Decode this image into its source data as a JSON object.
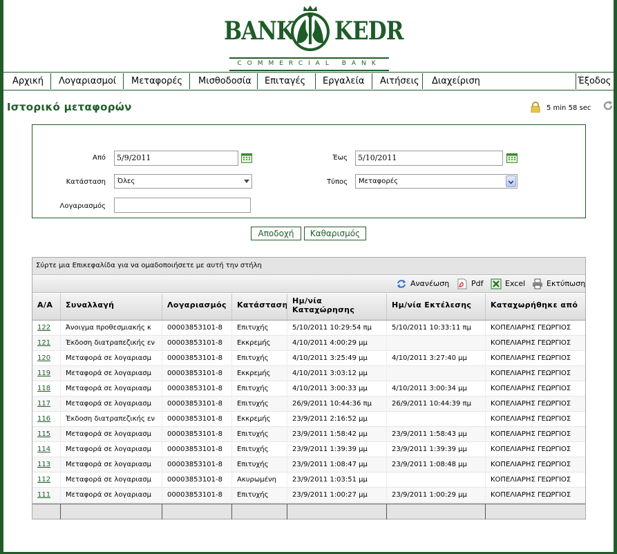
{
  "logo": {
    "left_word": "BANK",
    "right_word": "KEDR",
    "tagline": "COMMERCIAL BANK"
  },
  "nav": [
    {
      "label": "Αρχική"
    },
    {
      "label": "Λογαριασμοί"
    },
    {
      "label": "Μεταφορές"
    },
    {
      "label": "Μισθοδοσία"
    },
    {
      "label": "Επιταγές"
    },
    {
      "label": "Εργαλεία"
    },
    {
      "label": "Αιτήσεις"
    },
    {
      "label": "Διαχείριση"
    }
  ],
  "logout_label": "Έξοδος",
  "page_title": "Ιστορικό μεταφορών",
  "session_timer": "5 min 58 sec",
  "filter": {
    "from_label": "Από",
    "from_value": "5/9/2011",
    "to_label": "Έως",
    "to_value": "5/10/2011",
    "status_label": "Κατάσταση",
    "status_value": "Όλες",
    "type_label": "Τύπος",
    "type_value": "Μεταφορές",
    "account_label": "Λογαριασμός",
    "account_value": ""
  },
  "buttons": {
    "accept": "Αποδοχή",
    "clear": "Καθαρισμός"
  },
  "grid": {
    "group_hint": "Σύρτε μια Επικεφαλίδα για να ομαδοποιήσετε με αυτή την στήλη",
    "toolbar": {
      "refresh": "Ανανέωση",
      "pdf": "Pdf",
      "excel": "Excel",
      "print": "Εκτύπωση"
    },
    "columns": [
      {
        "label": "Α/Α"
      },
      {
        "label": "Συναλλαγή"
      },
      {
        "label": "Λογαριασμός"
      },
      {
        "label": "Κατάσταση"
      },
      {
        "label": "Ημ/νία Καταχώρησης"
      },
      {
        "label": "Ημ/νία Εκτέλεσης"
      },
      {
        "label": "Καταχωρήθηκε από"
      }
    ],
    "rows": [
      {
        "aa": "122",
        "tx": "Άνοιγμα προθεσμιακής κ",
        "acct": "00003853101-8",
        "status": "Επιτυχής",
        "reg": "5/10/2011 10:29:54 πμ",
        "exec": "5/10/2011 10:33:11 πμ",
        "by": "ΚΟΠΕΛΙΑΡΗΣ ΓΕΩΡΓΙΟΣ"
      },
      {
        "aa": "121",
        "tx": "Έκδοση διατραπεζικής εν",
        "acct": "00003853101-8",
        "status": "Εκκρεμής",
        "reg": "4/10/2011 4:00:29 μμ",
        "exec": "",
        "by": "ΚΟΠΕΛΙΑΡΗΣ ΓΕΩΡΓΙΟΣ"
      },
      {
        "aa": "120",
        "tx": "Μεταφορά σε λογαριασμ",
        "acct": "00003853101-8",
        "status": "Επιτυχής",
        "reg": "4/10/2011 3:25:49 μμ",
        "exec": "4/10/2011 3:27:40 μμ",
        "by": "ΚΟΠΕΛΙΑΡΗΣ ΓΕΩΡΓΙΟΣ"
      },
      {
        "aa": "119",
        "tx": "Μεταφορά σε λογαριασμ",
        "acct": "00003853101-8",
        "status": "Εκκρεμής",
        "reg": "4/10/2011 3:03:12 μμ",
        "exec": "",
        "by": "ΚΟΠΕΛΙΑΡΗΣ ΓΕΩΡΓΙΟΣ"
      },
      {
        "aa": "118",
        "tx": "Μεταφορά σε λογαριασμ",
        "acct": "00003853101-8",
        "status": "Επιτυχής",
        "reg": "4/10/2011 3:00:33 μμ",
        "exec": "4/10/2011 3:00:34 μμ",
        "by": "ΚΟΠΕΛΙΑΡΗΣ ΓΕΩΡΓΙΟΣ"
      },
      {
        "aa": "117",
        "tx": "Μεταφορά σε λογαριασμ",
        "acct": "00003853101-8",
        "status": "Επιτυχής",
        "reg": "26/9/2011 10:44:36 πμ",
        "exec": "26/9/2011 10:44:39 πμ",
        "by": "ΚΟΠΕΛΙΑΡΗΣ ΓΕΩΡΓΙΟΣ"
      },
      {
        "aa": "116",
        "tx": "Έκδοση διατραπεζικής εν",
        "acct": "00003853101-8",
        "status": "Εκκρεμής",
        "reg": "23/9/2011 2:16:52 μμ",
        "exec": "",
        "by": "ΚΟΠΕΛΙΑΡΗΣ ΓΕΩΡΓΙΟΣ"
      },
      {
        "aa": "115",
        "tx": "Μεταφορά σε λογαριασμ",
        "acct": "00003853101-8",
        "status": "Επιτυχής",
        "reg": "23/9/2011 1:58:42 μμ",
        "exec": "23/9/2011 1:58:43 μμ",
        "by": "ΚΟΠΕΛΙΑΡΗΣ ΓΕΩΡΓΙΟΣ"
      },
      {
        "aa": "114",
        "tx": "Μεταφορά σε λογαριασμ",
        "acct": "00003853101-8",
        "status": "Επιτυχής",
        "reg": "23/9/2011 1:39:39 μμ",
        "exec": "23/9/2011 1:39:39 μμ",
        "by": "ΚΟΠΕΛΙΑΡΗΣ ΓΕΩΡΓΙΟΣ"
      },
      {
        "aa": "113",
        "tx": "Μεταφορά σε λογαριασμ",
        "acct": "00003853101-8",
        "status": "Επιτυχής",
        "reg": "23/9/2011 1:08:47 μμ",
        "exec": "23/9/2011 1:08:48 μμ",
        "by": "ΚΟΠΕΛΙΑΡΗΣ ΓΕΩΡΓΙΟΣ"
      },
      {
        "aa": "112",
        "tx": "Μεταφορά σε λογαριασμ",
        "acct": "00003853101-8",
        "status": "Ακυρωμένη",
        "reg": "23/9/2011 1:03:51 μμ",
        "exec": "",
        "by": "ΚΟΠΕΛΙΑΡΗΣ ΓΕΩΡΓΙΟΣ"
      },
      {
        "aa": "111",
        "tx": "Μεταφορά σε λογαριασμ",
        "acct": "00003853101-8",
        "status": "Επιτυχής",
        "reg": "23/9/2011 1:00:27 μμ",
        "exec": "23/9/2011 1:00:29 μμ",
        "by": "ΚΟΠΕΛΙΑΡΗΣ ΓΕΩΡΓΙΟΣ"
      }
    ]
  },
  "colors": {
    "brand_green": "#1f5c28"
  },
  "icons": {
    "lock": "lock-icon",
    "refresh": "refresh-icon",
    "calendar": "calendar-icon",
    "pdf": "pdf-icon",
    "excel": "excel-icon",
    "print": "printer-icon"
  }
}
